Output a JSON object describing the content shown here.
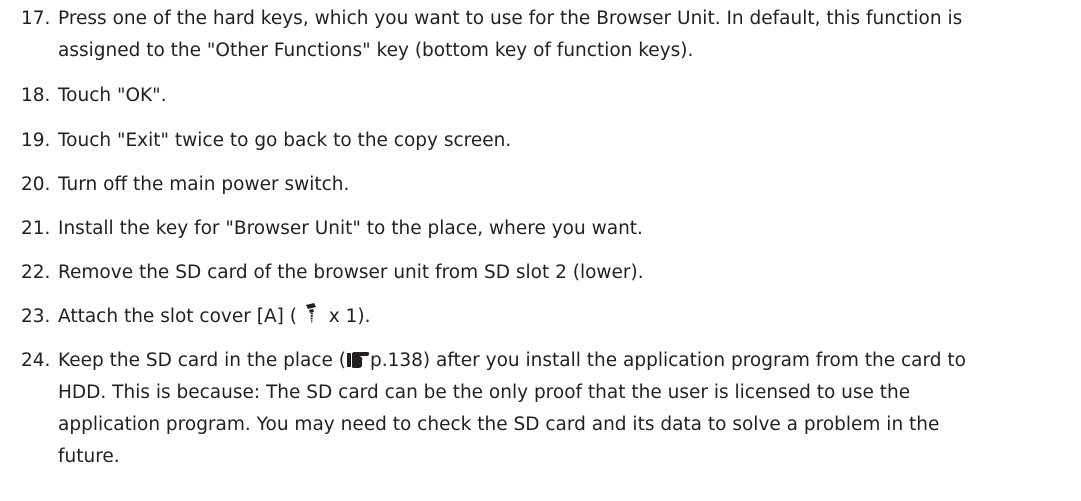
{
  "steps": [
    {
      "num": "17.",
      "lines": [
        "Press one of the hard keys, which you want to use for the Browser Unit. In default, this function is",
        "assigned to the \"Other Functions\" key (bottom key of function keys)."
      ]
    },
    {
      "num": "18.",
      "lines": [
        "Touch \"OK\"."
      ]
    },
    {
      "num": "19.",
      "lines": [
        "Touch \"Exit\" twice to go back to the copy screen."
      ]
    },
    {
      "num": "20.",
      "lines": [
        "Turn off the main power switch."
      ]
    },
    {
      "num": "21.",
      "lines": [
        "Install the key for \"Browser Unit\" to the place, where you want."
      ]
    },
    {
      "num": "22.",
      "lines": [
        "Remove the SD card of the browser unit from SD slot 2 (lower)."
      ]
    },
    {
      "num": "23.",
      "before": "Attach the slot cover [A] (",
      "icon": "screw-icon",
      "after": " x 1)."
    },
    {
      "num": "24.",
      "line1_before": "Keep the SD card in the place (",
      "icon": "pointing-hand-icon",
      "line1_ref": "p.138",
      "line1_after": ") after you install the application program from the card to",
      "lines_rest": [
        "HDD. This is because: The SD card can be the only proof that the user is licensed to use the",
        "application program. You may need to check the SD card and its data to solve a problem in the",
        "future."
      ]
    }
  ]
}
